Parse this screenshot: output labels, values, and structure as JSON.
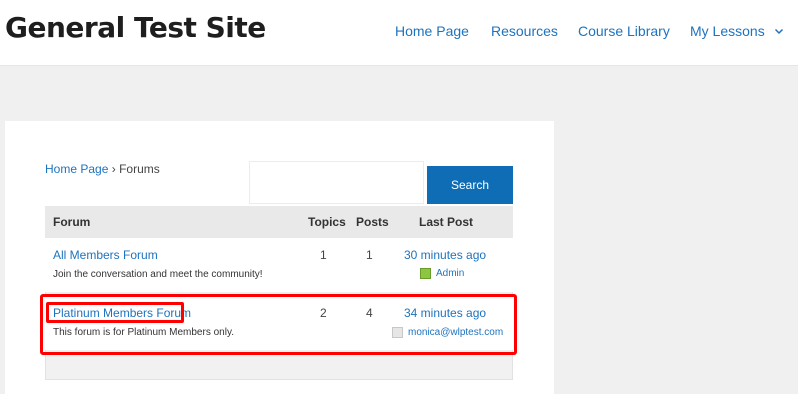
{
  "site": {
    "title": "General Test Site"
  },
  "nav": {
    "items": [
      {
        "label": "Home Page"
      },
      {
        "label": "Resources"
      },
      {
        "label": "Course Library"
      },
      {
        "label": "My Lessons"
      }
    ]
  },
  "breadcrumb": {
    "home": "Home Page",
    "separator": "›",
    "current": "Forums"
  },
  "search": {
    "value": "",
    "button_label": "Search"
  },
  "table": {
    "headers": {
      "forum": "Forum",
      "topics": "Topics",
      "posts": "Posts",
      "last_post": "Last Post"
    },
    "rows": [
      {
        "title": "All Members Forum",
        "description": "Join the conversation and meet the community!",
        "topics": "1",
        "posts": "1",
        "last_post": "30 minutes ago",
        "author": "Admin"
      },
      {
        "title": "Platinum Members Forum",
        "description": "This forum is for Platinum Members only.",
        "topics": "2",
        "posts": "4",
        "last_post": "34 minutes ago",
        "author": "monica@wlptest.com"
      }
    ]
  },
  "colors": {
    "link": "#1e73be",
    "button": "#0e6db5",
    "highlight": "#ff0000"
  }
}
